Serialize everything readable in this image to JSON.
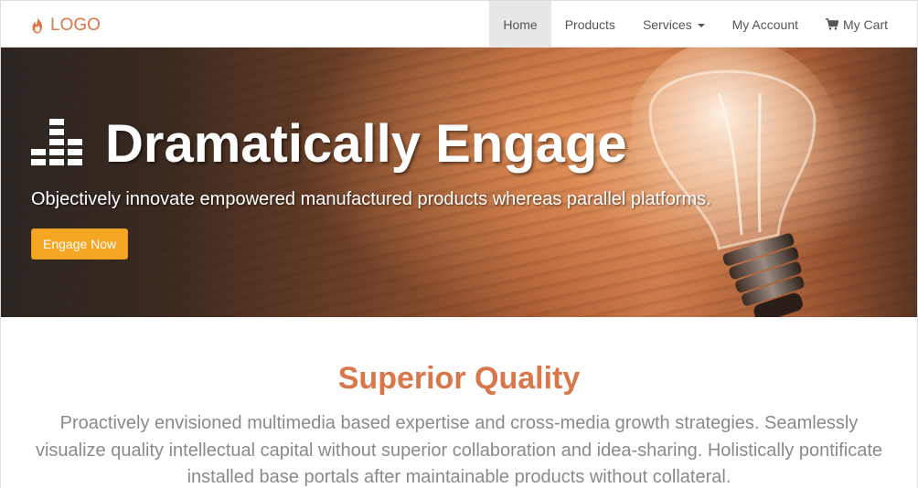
{
  "brand": {
    "label": "LOGO",
    "icon": "fire-icon",
    "color": "#d9774a"
  },
  "nav": {
    "items": [
      {
        "label": "Home",
        "active": true
      },
      {
        "label": "Products"
      },
      {
        "label": "Services",
        "dropdown": true
      },
      {
        "label": "My Account"
      },
      {
        "label": "My Cart",
        "icon": "shopping-cart-icon"
      }
    ]
  },
  "hero": {
    "icon": "equalizer-bars-icon",
    "title": "Dramatically Engage",
    "subtitle": "Objectively innovate empowered manufactured products whereas parallel platforms.",
    "button_label": "Engage Now",
    "button_color": "#f5a623"
  },
  "section": {
    "title": "Superior Quality",
    "body": "Proactively envisioned multimedia based expertise and cross-media growth strategies. Seamlessly visualize quality intellectual capital without superior collaboration and idea-sharing. Holistically pontificate installed base portals after maintainable products without collateral."
  }
}
